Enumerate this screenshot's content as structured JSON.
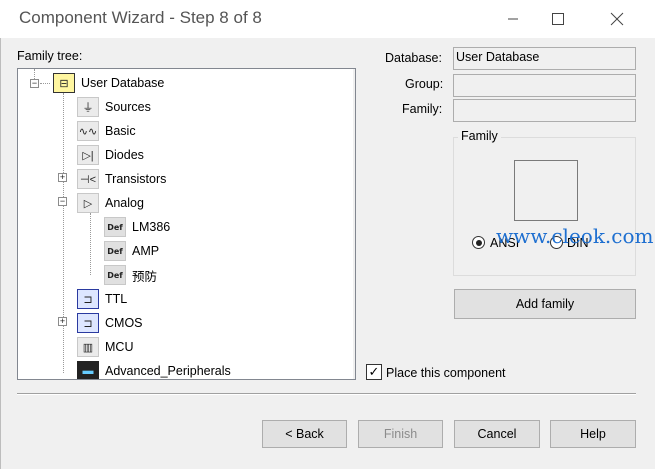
{
  "window": {
    "title": "Component Wizard - Step 8 of 8"
  },
  "tree": {
    "label": "Family tree:",
    "root": "User Database",
    "items": [
      {
        "label": "Sources",
        "icon": "⏚"
      },
      {
        "label": "Basic",
        "icon": "∿∿"
      },
      {
        "label": "Diodes",
        "icon": "▷|"
      },
      {
        "label": "Transistors",
        "icon": "⊣<"
      },
      {
        "label": "Analog",
        "icon": "▷"
      },
      {
        "label": "LM386",
        "icon": "Def"
      },
      {
        "label": "AMP",
        "icon": "Def"
      },
      {
        "label": "预防",
        "icon": "Def"
      },
      {
        "label": "TTL",
        "icon": "⊐"
      },
      {
        "label": "CMOS",
        "icon": "⊐"
      },
      {
        "label": "MCU",
        "icon": "▥"
      },
      {
        "label": "Advanced_Peripherals",
        "icon": "▬"
      }
    ]
  },
  "form": {
    "database_label": "Database:",
    "database_value": "User Database",
    "group_label": "Group:",
    "group_value": "",
    "family_label": "Family:",
    "family_value": ""
  },
  "family_group": {
    "title": "Family",
    "ansi": "ANSI",
    "din": "DIN",
    "selected": "ANSI"
  },
  "add_family": "Add family",
  "place_component": "Place this component",
  "watermark": "www.cleok.com",
  "buttons": {
    "back": "< Back",
    "finish": "Finish",
    "cancel": "Cancel",
    "help": "Help"
  },
  "colors": {
    "watermark": "#1e6fd0",
    "tree_bg": "#ffffff",
    "dialog_bg": "#f0f0f0"
  }
}
